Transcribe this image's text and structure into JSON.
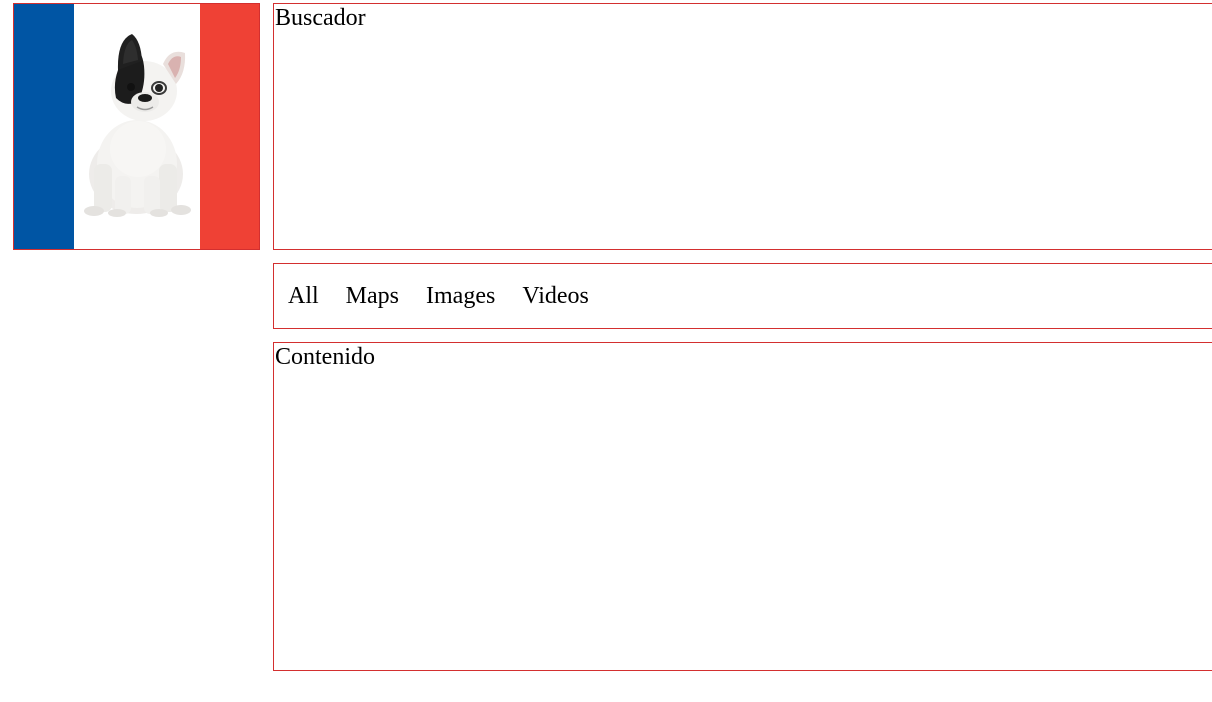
{
  "logo": {
    "icon": "french-bulldog-flag-logo",
    "colors": {
      "blue": "#0055a4",
      "white": "#ffffff",
      "red": "#ef4135"
    }
  },
  "search": {
    "title": "Buscador"
  },
  "nav": {
    "items": [
      {
        "label": "All"
      },
      {
        "label": "Maps"
      },
      {
        "label": "Images"
      },
      {
        "label": "Videos"
      }
    ]
  },
  "content": {
    "title": "Contenido"
  }
}
